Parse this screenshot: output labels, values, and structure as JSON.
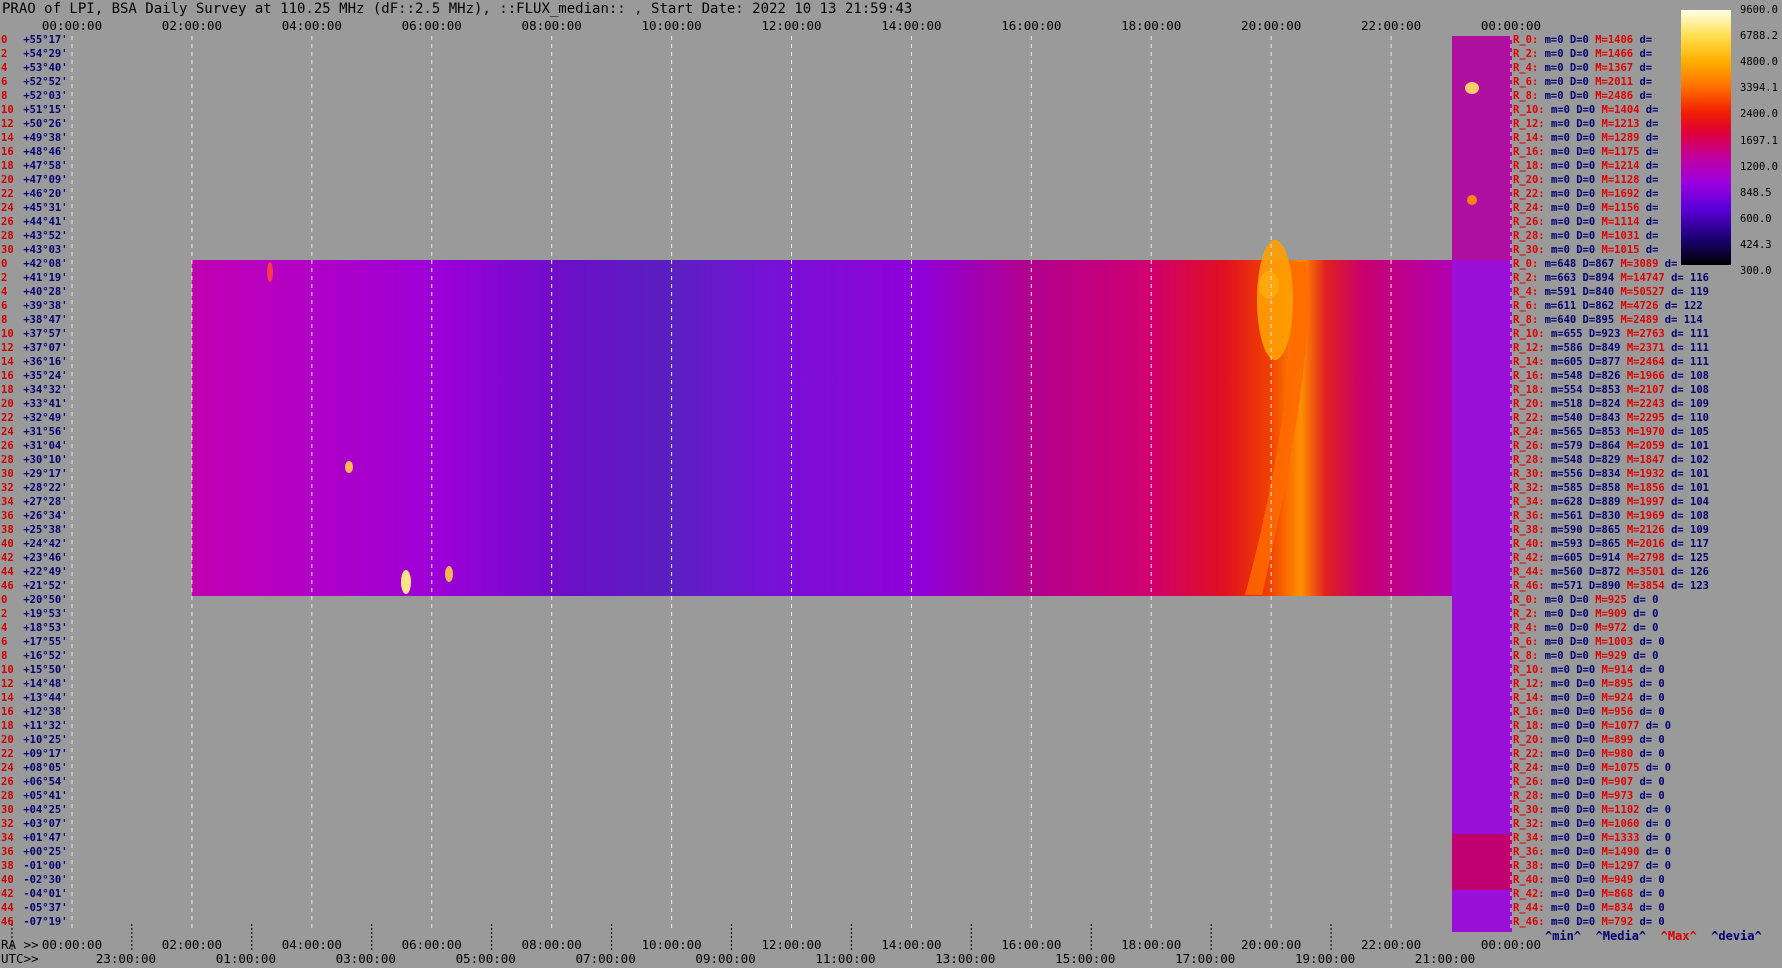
{
  "title": "PRAO of LPI, BSA Daily Survey at 110.25 MHz (dF::2.5 MHz), ::FLUX_median:: , Start Date: 2022 10 13 21:59:43",
  "chart_data": {
    "type": "heatmap",
    "x_top_ticks": [
      "00:00:00",
      "02:00:00",
      "04:00:00",
      "06:00:00",
      "08:00:00",
      "10:00:00",
      "12:00:00",
      "14:00:00",
      "16:00:00",
      "18:00:00",
      "20:00:00",
      "22:00:00",
      "00:00:00"
    ],
    "x_bottom_ra_ticks": [
      "00:00:00",
      "02:00:00",
      "04:00:00",
      "06:00:00",
      "08:00:00",
      "10:00:00",
      "12:00:00",
      "14:00:00",
      "16:00:00",
      "18:00:00",
      "20:00:00",
      "22:00:00",
      "00:00:00"
    ],
    "x_bottom_utc_ticks": [
      "23:00:00",
      "01:00:00",
      "03:00:00",
      "05:00:00",
      "07:00:00",
      "09:00:00",
      "11:00:00",
      "13:00:00",
      "15:00:00",
      "17:00:00",
      "19:00:00",
      "21:00:00"
    ],
    "ra_axis_label": "RA >>",
    "utc_axis_label": "UTC>>",
    "row_numbers": [
      "0",
      "2",
      "4",
      "6",
      "8",
      "10",
      "12",
      "14",
      "16",
      "18",
      "20",
      "22",
      "24",
      "26",
      "28",
      "30",
      "0",
      "2",
      "4",
      "6",
      "8",
      "10",
      "12",
      "14",
      "16",
      "18",
      "20",
      "22",
      "24",
      "26",
      "28",
      "30",
      "32",
      "34",
      "36",
      "38",
      "40",
      "42",
      "44",
      "46",
      "0",
      "2",
      "4",
      "6",
      "8",
      "10",
      "12",
      "14",
      "16",
      "18",
      "20",
      "22",
      "24",
      "26",
      "28",
      "30",
      "32",
      "34",
      "36",
      "38",
      "40",
      "42",
      "44",
      "46"
    ],
    "declinations": [
      "+55°17'",
      "+54°29'",
      "+53°40'",
      "+52°52'",
      "+52°03'",
      "+51°15'",
      "+50°26'",
      "+49°38'",
      "+48°46'",
      "+47°58'",
      "+47°09'",
      "+46°20'",
      "+45°31'",
      "+44°41'",
      "+43°52'",
      "+43°03'",
      "+42°08'",
      "+41°19'",
      "+40°28'",
      "+39°38'",
      "+38°47'",
      "+37°57'",
      "+37°07'",
      "+36°16'",
      "+35°24'",
      "+34°32'",
      "+33°41'",
      "+32°49'",
      "+31°56'",
      "+31°04'",
      "+30°10'",
      "+29°17'",
      "+28°22'",
      "+27°28'",
      "+26°34'",
      "+25°38'",
      "+24°42'",
      "+23°46'",
      "+22°49'",
      "+21°52'",
      "+20°50'",
      "+19°53'",
      "+18°53'",
      "+17°55'",
      "+16°52'",
      "+15°50'",
      "+14°48'",
      "+13°44'",
      "+12°38'",
      "+11°32'",
      "+10°25'",
      "+09°17'",
      "+08°05'",
      "+06°54'",
      "+05°41'",
      "+04°25'",
      "+03°07'",
      "+01°47'",
      "+00°25'",
      "-01°00'",
      "-02°30'",
      "-04°01'",
      "-05°37'",
      "-07°19'"
    ],
    "colorbar_ticks": [
      "9600.0",
      "6788.2",
      "4800.0",
      "3394.1",
      "2400.0",
      "1697.1",
      "1200.0",
      "848.5",
      "600.0",
      "424.3",
      "300.0"
    ],
    "row_stats": [
      [
        "R_0:",
        "m=0",
        "D=0",
        "M=1406",
        "d="
      ],
      [
        "R_2:",
        "m=0",
        "D=0",
        "M=1466",
        "d="
      ],
      [
        "R_4:",
        "m=0",
        "D=0",
        "M=1367",
        "d="
      ],
      [
        "R_6:",
        "m=0",
        "D=0",
        "M=2011",
        "d="
      ],
      [
        "R_8:",
        "m=0",
        "D=0",
        "M=2486",
        "d="
      ],
      [
        "R_10:",
        "m=0",
        "D=0",
        "M=1404",
        "d="
      ],
      [
        "R_12:",
        "m=0",
        "D=0",
        "M=1213",
        "d="
      ],
      [
        "R_14:",
        "m=0",
        "D=0",
        "M=1289",
        "d="
      ],
      [
        "R_16:",
        "m=0",
        "D=0",
        "M=1175",
        "d="
      ],
      [
        "R_18:",
        "m=0",
        "D=0",
        "M=1214",
        "d="
      ],
      [
        "R_20:",
        "m=0",
        "D=0",
        "M=1128",
        "d="
      ],
      [
        "R_22:",
        "m=0",
        "D=0",
        "M=1692",
        "d="
      ],
      [
        "R_24:",
        "m=0",
        "D=0",
        "M=1156",
        "d="
      ],
      [
        "R_26:",
        "m=0",
        "D=0",
        "M=1114",
        "d="
      ],
      [
        "R_28:",
        "m=0",
        "D=0",
        "M=1031",
        "d="
      ],
      [
        "R_30:",
        "m=0",
        "D=0",
        "M=1015",
        "d="
      ],
      [
        "R_0:",
        "m=648",
        "D=867",
        "M=3089",
        "d="
      ],
      [
        "R_2:",
        "m=663",
        "D=894",
        "M=14747",
        "d= 116"
      ],
      [
        "R_4:",
        "m=591",
        "D=840",
        "M=50527",
        "d= 119"
      ],
      [
        "R_6:",
        "m=611",
        "D=862",
        "M=4726",
        "d= 122"
      ],
      [
        "R_8:",
        "m=640",
        "D=895",
        "M=2489",
        "d= 114"
      ],
      [
        "R_10:",
        "m=655",
        "D=923",
        "M=2763",
        "d= 111"
      ],
      [
        "R_12:",
        "m=586",
        "D=849",
        "M=2371",
        "d= 111"
      ],
      [
        "R_14:",
        "m=605",
        "D=877",
        "M=2464",
        "d= 111"
      ],
      [
        "R_16:",
        "m=548",
        "D=826",
        "M=1966",
        "d= 108"
      ],
      [
        "R_18:",
        "m=554",
        "D=853",
        "M=2107",
        "d= 108"
      ],
      [
        "R_20:",
        "m=518",
        "D=824",
        "M=2243",
        "d= 109"
      ],
      [
        "R_22:",
        "m=540",
        "D=843",
        "M=2295",
        "d= 110"
      ],
      [
        "R_24:",
        "m=565",
        "D=853",
        "M=1970",
        "d= 105"
      ],
      [
        "R_26:",
        "m=579",
        "D=864",
        "M=2059",
        "d= 101"
      ],
      [
        "R_28:",
        "m=548",
        "D=829",
        "M=1847",
        "d= 102"
      ],
      [
        "R_30:",
        "m=556",
        "D=834",
        "M=1932",
        "d= 101"
      ],
      [
        "R_32:",
        "m=585",
        "D=858",
        "M=1856",
        "d= 101"
      ],
      [
        "R_34:",
        "m=628",
        "D=889",
        "M=1997",
        "d= 104"
      ],
      [
        "R_36:",
        "m=561",
        "D=830",
        "M=1969",
        "d= 108"
      ],
      [
        "R_38:",
        "m=590",
        "D=865",
        "M=2126",
        "d= 109"
      ],
      [
        "R_40:",
        "m=593",
        "D=865",
        "M=2016",
        "d= 117"
      ],
      [
        "R_42:",
        "m=605",
        "D=914",
        "M=2798",
        "d= 125"
      ],
      [
        "R_44:",
        "m=560",
        "D=872",
        "M=3501",
        "d= 126"
      ],
      [
        "R_46:",
        "m=571",
        "D=890",
        "M=3854",
        "d= 123"
      ],
      [
        "R_0:",
        "m=0",
        "D=0",
        "M=925",
        "d= 0"
      ],
      [
        "R_2:",
        "m=0",
        "D=0",
        "M=909",
        "d= 0"
      ],
      [
        "R_4:",
        "m=0",
        "D=0",
        "M=972",
        "d= 0"
      ],
      [
        "R_6:",
        "m=0",
        "D=0",
        "M=1003",
        "d= 0"
      ],
      [
        "R_8:",
        "m=0",
        "D=0",
        "M=929",
        "d= 0"
      ],
      [
        "R_10:",
        "m=0",
        "D=0",
        "M=914",
        "d= 0"
      ],
      [
        "R_12:",
        "m=0",
        "D=0",
        "M=895",
        "d= 0"
      ],
      [
        "R_14:",
        "m=0",
        "D=0",
        "M=924",
        "d= 0"
      ],
      [
        "R_16:",
        "m=0",
        "D=0",
        "M=956",
        "d= 0"
      ],
      [
        "R_18:",
        "m=0",
        "D=0",
        "M=1077",
        "d= 0"
      ],
      [
        "R_20:",
        "m=0",
        "D=0",
        "M=899",
        "d= 0"
      ],
      [
        "R_22:",
        "m=0",
        "D=0",
        "M=980",
        "d= 0"
      ],
      [
        "R_24:",
        "m=0",
        "D=0",
        "M=1075",
        "d= 0"
      ],
      [
        "R_26:",
        "m=0",
        "D=0",
        "M=907",
        "d= 0"
      ],
      [
        "R_28:",
        "m=0",
        "D=0",
        "M=973",
        "d= 0"
      ],
      [
        "R_30:",
        "m=0",
        "D=0",
        "M=1102",
        "d= 0"
      ],
      [
        "R_32:",
        "m=0",
        "D=0",
        "M=1060",
        "d= 0"
      ],
      [
        "R_34:",
        "m=0",
        "D=0",
        "M=1333",
        "d= 0"
      ],
      [
        "R_36:",
        "m=0",
        "D=0",
        "M=1490",
        "d= 0"
      ],
      [
        "R_38:",
        "m=0",
        "D=0",
        "M=1297",
        "d= 0"
      ],
      [
        "R_40:",
        "m=0",
        "D=0",
        "M=949",
        "d= 0"
      ],
      [
        "R_42:",
        "m=0",
        "D=0",
        "M=868",
        "d= 0"
      ],
      [
        "R_44:",
        "m=0",
        "D=0",
        "M=834",
        "d= 0"
      ],
      [
        "R_46:",
        "m=0",
        "D=0",
        "M=792",
        "d= 0"
      ]
    ],
    "bottom_legend": [
      "^min^",
      "^Media^",
      "^Max^",
      "^devia^"
    ]
  }
}
